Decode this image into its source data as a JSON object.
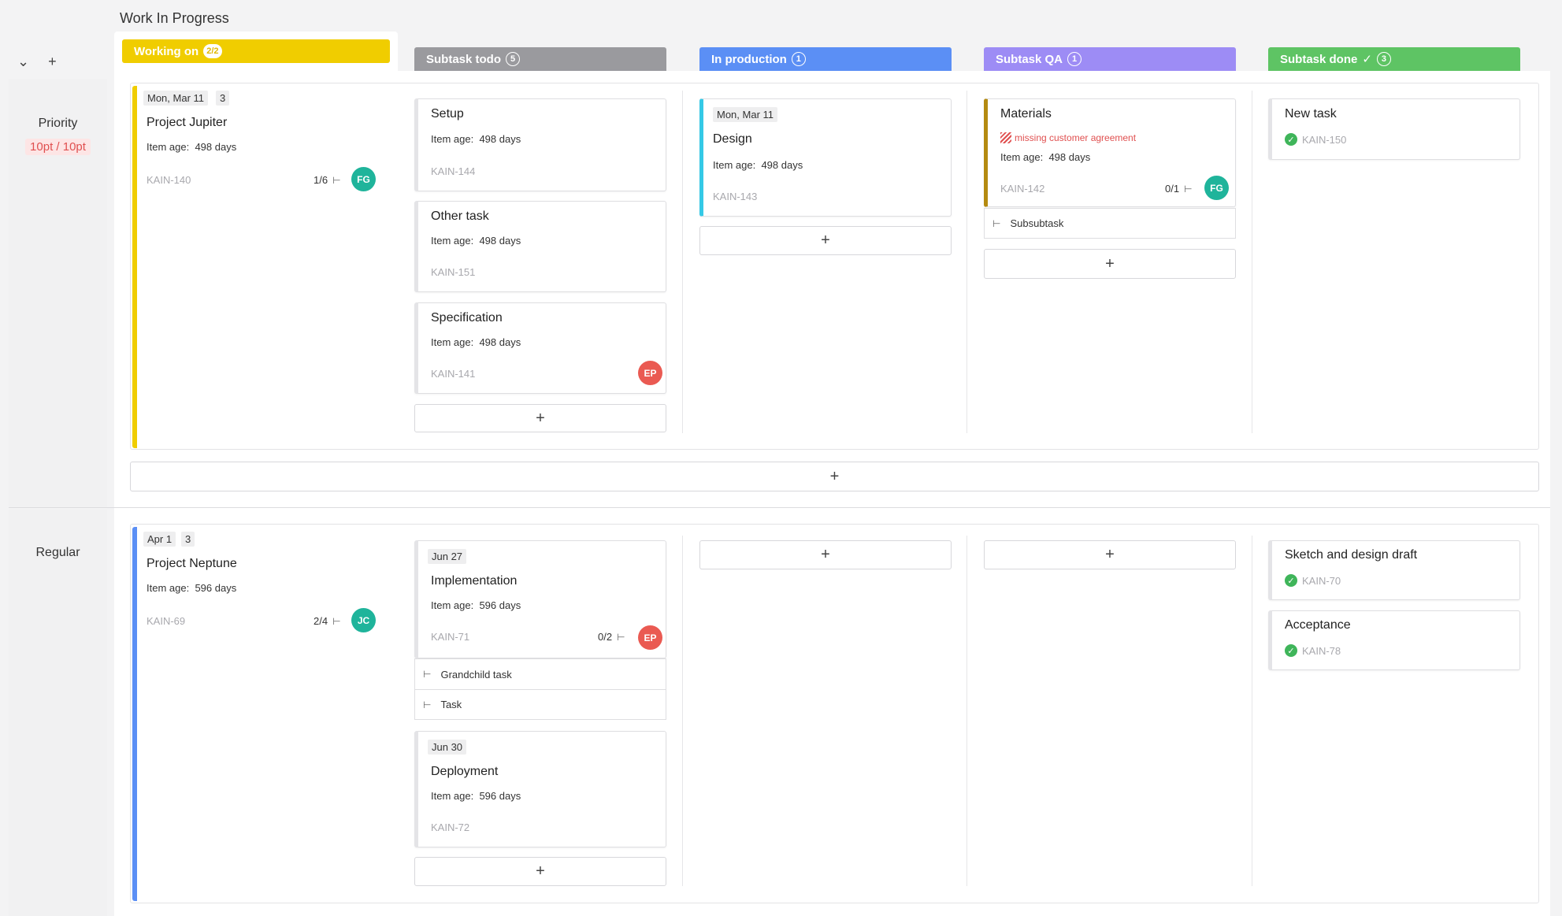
{
  "page_title": "Work In Progress",
  "rail_controls": {
    "collapse": "⌄",
    "add": "+"
  },
  "colors": {
    "working_on": "#f0cd00",
    "subtask_todo": "#9a9a9e",
    "in_production": "#5b8ff5",
    "subtask_qa": "#9d8cf5",
    "subtask_done": "#5ec464",
    "avatar_teal": "#1fb49b",
    "avatar_red": "#ea5a52",
    "blue_bar": "#5b8ff5",
    "cyan_bar": "#35c9e6",
    "brown_bar": "#b48a10"
  },
  "columns": [
    {
      "label": "Working on",
      "count": "2/2"
    },
    {
      "label": "Subtask todo",
      "count": "5"
    },
    {
      "label": "In production",
      "count": "1"
    },
    {
      "label": "Subtask QA",
      "count": "1"
    },
    {
      "label": "Subtask done",
      "count": "3",
      "check": "✓"
    }
  ],
  "lanes": [
    {
      "title": "Priority",
      "wip": "10pt / 10pt"
    },
    {
      "title": "Regular"
    }
  ],
  "add_label": "+",
  "cards": {
    "jupiter": {
      "date": "Mon, Mar 11",
      "count": "3",
      "title": "Project Jupiter",
      "age_label": "Item age:",
      "age": "498 days",
      "key": "KAIN-140",
      "progress": "1/6",
      "avatar": "FG"
    },
    "setup": {
      "title": "Setup",
      "age_label": "Item age:",
      "age": "498 days",
      "key": "KAIN-144"
    },
    "other": {
      "title": "Other task",
      "age_label": "Item age:",
      "age": "498 days",
      "key": "KAIN-151"
    },
    "spec": {
      "title": "Specification",
      "age_label": "Item age:",
      "age": "498 days",
      "key": "KAIN-141",
      "avatar": "EP"
    },
    "design": {
      "date": "Mon, Mar 11",
      "title": "Design",
      "age_label": "Item age:",
      "age": "498 days",
      "key": "KAIN-143"
    },
    "materials": {
      "title": "Materials",
      "warning": "missing customer agreement",
      "age_label": "Item age:",
      "age": "498 days",
      "key": "KAIN-142",
      "progress": "0/1",
      "avatar": "FG",
      "subtask": "Subsubtask"
    },
    "newtask": {
      "title": "New task",
      "key": "KAIN-150"
    },
    "neptune": {
      "date": "Apr 1",
      "count": "3",
      "title": "Project Neptune",
      "age_label": "Item age:",
      "age": "596 days",
      "key": "KAIN-69",
      "progress": "2/4",
      "avatar": "JC"
    },
    "impl": {
      "date": "Jun 27",
      "title": "Implementation",
      "age_label": "Item age:",
      "age": "596 days",
      "key": "KAIN-71",
      "progress": "0/2",
      "avatar": "EP",
      "subtasks": [
        "Grandchild task",
        "Task"
      ]
    },
    "deploy": {
      "date": "Jun 30",
      "title": "Deployment",
      "age_label": "Item age:",
      "age": "596 days",
      "key": "KAIN-72"
    },
    "sketch": {
      "title": "Sketch and design draft",
      "key": "KAIN-70"
    },
    "accept": {
      "title": "Acceptance",
      "key": "KAIN-78"
    }
  }
}
